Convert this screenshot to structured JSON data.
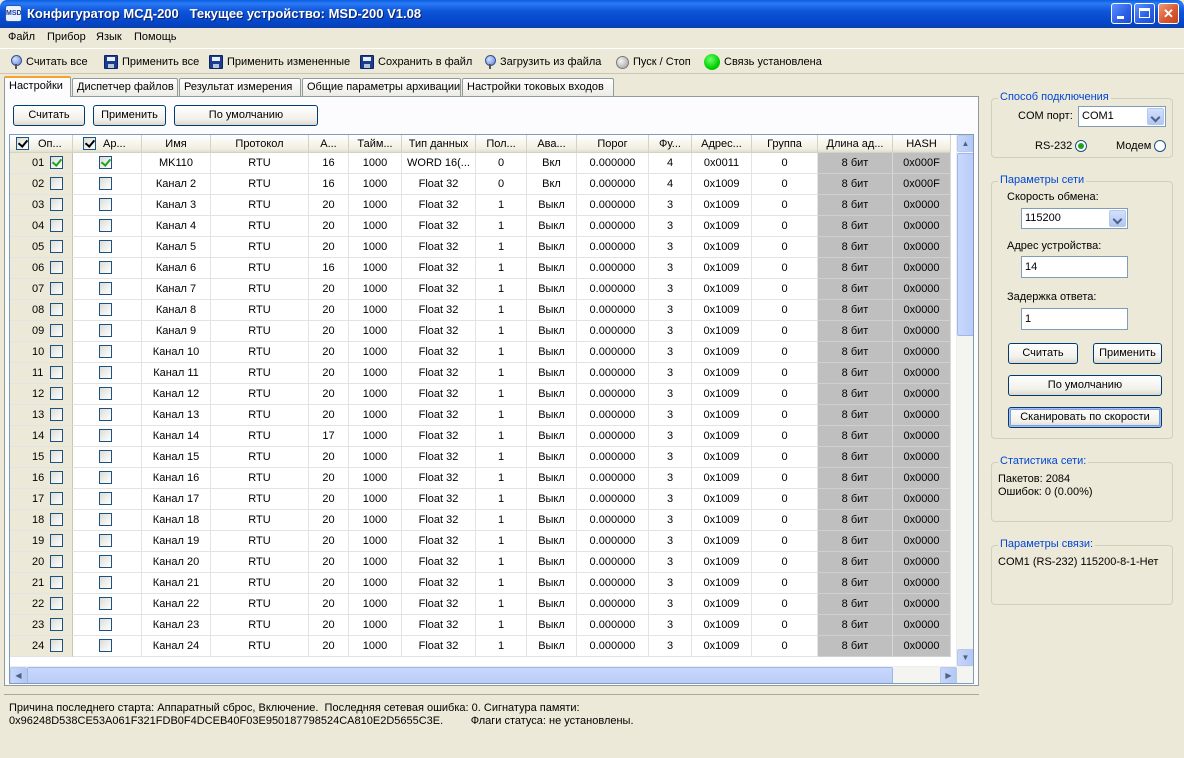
{
  "window": {
    "title": "Конфигуратор МСД-200   Текущее устройство: MSD-200 V1.08",
    "icon_text": "MSD"
  },
  "menu": [
    "Файл",
    "Прибор",
    "Язык",
    "Помощь"
  ],
  "toolbar": {
    "read_all": "Считать все",
    "apply_all": "Применить все",
    "apply_changed": "Применить измененные",
    "save_file": "Сохранить в файл",
    "load_file": "Загрузить из файла",
    "start_stop": "Пуск / Стоп",
    "connection": "Связь установлена",
    "connection_color": "#00d100"
  },
  "tabs": [
    "Настройки",
    "Диспетчер файлов",
    "Результат измерения",
    "Общие параметры архивации",
    "Настройки токовых входов"
  ],
  "panel_buttons": {
    "read": "Считать",
    "apply": "Применить",
    "default": "По умолчанию"
  },
  "table": {
    "columns": [
      "Оп...",
      "Ар...",
      "Имя",
      "Протокол",
      "А...",
      "Тайм...",
      "Тип данных",
      "Пол...",
      "Ава...",
      "Порог",
      "Фу...",
      "Адрес...",
      "Группа",
      "Длина ад...",
      "HASH"
    ],
    "rows": [
      {
        "n": "01",
        "op": true,
        "ar": true,
        "name": "MK110",
        "proto": "RTU",
        "a": "16",
        "t": "1000",
        "type": "WORD 16(...",
        "pol": "0",
        "ava": "Вкл",
        "thr": "0.000000",
        "fu": "4",
        "addr": "0x0011",
        "grp": "0",
        "len": "8 бит",
        "hash": "0x000F"
      },
      {
        "n": "02",
        "op": false,
        "ar": false,
        "name": "Канал 2",
        "proto": "RTU",
        "a": "16",
        "t": "1000",
        "type": "Float 32",
        "pol": "0",
        "ava": "Вкл",
        "thr": "0.000000",
        "fu": "4",
        "addr": "0x1009",
        "grp": "0",
        "len": "8 бит",
        "hash": "0x000F"
      },
      {
        "n": "03",
        "op": false,
        "ar": false,
        "name": "Канал 3",
        "proto": "RTU",
        "a": "20",
        "t": "1000",
        "type": "Float 32",
        "pol": "1",
        "ava": "Выкл",
        "thr": "0.000000",
        "fu": "3",
        "addr": "0x1009",
        "grp": "0",
        "len": "8 бит",
        "hash": "0x0000"
      },
      {
        "n": "04",
        "op": false,
        "ar": false,
        "name": "Канал 4",
        "proto": "RTU",
        "a": "20",
        "t": "1000",
        "type": "Float 32",
        "pol": "1",
        "ava": "Выкл",
        "thr": "0.000000",
        "fu": "3",
        "addr": "0x1009",
        "grp": "0",
        "len": "8 бит",
        "hash": "0x0000"
      },
      {
        "n": "05",
        "op": false,
        "ar": false,
        "name": "Канал 5",
        "proto": "RTU",
        "a": "20",
        "t": "1000",
        "type": "Float 32",
        "pol": "1",
        "ava": "Выкл",
        "thr": "0.000000",
        "fu": "3",
        "addr": "0x1009",
        "grp": "0",
        "len": "8 бит",
        "hash": "0x0000"
      },
      {
        "n": "06",
        "op": false,
        "ar": false,
        "name": "Канал 6",
        "proto": "RTU",
        "a": "16",
        "t": "1000",
        "type": "Float 32",
        "pol": "1",
        "ava": "Выкл",
        "thr": "0.000000",
        "fu": "3",
        "addr": "0x1009",
        "grp": "0",
        "len": "8 бит",
        "hash": "0x0000"
      },
      {
        "n": "07",
        "op": false,
        "ar": false,
        "name": "Канал 7",
        "proto": "RTU",
        "a": "20",
        "t": "1000",
        "type": "Float 32",
        "pol": "1",
        "ava": "Выкл",
        "thr": "0.000000",
        "fu": "3",
        "addr": "0x1009",
        "grp": "0",
        "len": "8 бит",
        "hash": "0x0000"
      },
      {
        "n": "08",
        "op": false,
        "ar": false,
        "name": "Канал 8",
        "proto": "RTU",
        "a": "20",
        "t": "1000",
        "type": "Float 32",
        "pol": "1",
        "ava": "Выкл",
        "thr": "0.000000",
        "fu": "3",
        "addr": "0x1009",
        "grp": "0",
        "len": "8 бит",
        "hash": "0x0000"
      },
      {
        "n": "09",
        "op": false,
        "ar": false,
        "name": "Канал 9",
        "proto": "RTU",
        "a": "20",
        "t": "1000",
        "type": "Float 32",
        "pol": "1",
        "ava": "Выкл",
        "thr": "0.000000",
        "fu": "3",
        "addr": "0x1009",
        "grp": "0",
        "len": "8 бит",
        "hash": "0x0000"
      },
      {
        "n": "10",
        "op": false,
        "ar": false,
        "name": "Канал 10",
        "proto": "RTU",
        "a": "20",
        "t": "1000",
        "type": "Float 32",
        "pol": "1",
        "ava": "Выкл",
        "thr": "0.000000",
        "fu": "3",
        "addr": "0x1009",
        "grp": "0",
        "len": "8 бит",
        "hash": "0x0000"
      },
      {
        "n": "11",
        "op": false,
        "ar": false,
        "name": "Канал 11",
        "proto": "RTU",
        "a": "20",
        "t": "1000",
        "type": "Float 32",
        "pol": "1",
        "ava": "Выкл",
        "thr": "0.000000",
        "fu": "3",
        "addr": "0x1009",
        "grp": "0",
        "len": "8 бит",
        "hash": "0x0000"
      },
      {
        "n": "12",
        "op": false,
        "ar": false,
        "name": "Канал 12",
        "proto": "RTU",
        "a": "20",
        "t": "1000",
        "type": "Float 32",
        "pol": "1",
        "ava": "Выкл",
        "thr": "0.000000",
        "fu": "3",
        "addr": "0x1009",
        "grp": "0",
        "len": "8 бит",
        "hash": "0x0000"
      },
      {
        "n": "13",
        "op": false,
        "ar": false,
        "name": "Канал 13",
        "proto": "RTU",
        "a": "20",
        "t": "1000",
        "type": "Float 32",
        "pol": "1",
        "ava": "Выкл",
        "thr": "0.000000",
        "fu": "3",
        "addr": "0x1009",
        "grp": "0",
        "len": "8 бит",
        "hash": "0x0000"
      },
      {
        "n": "14",
        "op": false,
        "ar": false,
        "name": "Канал 14",
        "proto": "RTU",
        "a": "17",
        "t": "1000",
        "type": "Float 32",
        "pol": "1",
        "ava": "Выкл",
        "thr": "0.000000",
        "fu": "3",
        "addr": "0x1009",
        "grp": "0",
        "len": "8 бит",
        "hash": "0x0000"
      },
      {
        "n": "15",
        "op": false,
        "ar": false,
        "name": "Канал 15",
        "proto": "RTU",
        "a": "20",
        "t": "1000",
        "type": "Float 32",
        "pol": "1",
        "ava": "Выкл",
        "thr": "0.000000",
        "fu": "3",
        "addr": "0x1009",
        "grp": "0",
        "len": "8 бит",
        "hash": "0x0000"
      },
      {
        "n": "16",
        "op": false,
        "ar": false,
        "name": "Канал 16",
        "proto": "RTU",
        "a": "20",
        "t": "1000",
        "type": "Float 32",
        "pol": "1",
        "ava": "Выкл",
        "thr": "0.000000",
        "fu": "3",
        "addr": "0x1009",
        "grp": "0",
        "len": "8 бит",
        "hash": "0x0000"
      },
      {
        "n": "17",
        "op": false,
        "ar": false,
        "name": "Канал 17",
        "proto": "RTU",
        "a": "20",
        "t": "1000",
        "type": "Float 32",
        "pol": "1",
        "ava": "Выкл",
        "thr": "0.000000",
        "fu": "3",
        "addr": "0x1009",
        "grp": "0",
        "len": "8 бит",
        "hash": "0x0000"
      },
      {
        "n": "18",
        "op": false,
        "ar": false,
        "name": "Канал 18",
        "proto": "RTU",
        "a": "20",
        "t": "1000",
        "type": "Float 32",
        "pol": "1",
        "ava": "Выкл",
        "thr": "0.000000",
        "fu": "3",
        "addr": "0x1009",
        "grp": "0",
        "len": "8 бит",
        "hash": "0x0000"
      },
      {
        "n": "19",
        "op": false,
        "ar": false,
        "name": "Канал 19",
        "proto": "RTU",
        "a": "20",
        "t": "1000",
        "type": "Float 32",
        "pol": "1",
        "ava": "Выкл",
        "thr": "0.000000",
        "fu": "3",
        "addr": "0x1009",
        "grp": "0",
        "len": "8 бит",
        "hash": "0x0000"
      },
      {
        "n": "20",
        "op": false,
        "ar": false,
        "name": "Канал 20",
        "proto": "RTU",
        "a": "20",
        "t": "1000",
        "type": "Float 32",
        "pol": "1",
        "ava": "Выкл",
        "thr": "0.000000",
        "fu": "3",
        "addr": "0x1009",
        "grp": "0",
        "len": "8 бит",
        "hash": "0x0000"
      },
      {
        "n": "21",
        "op": false,
        "ar": false,
        "name": "Канал 21",
        "proto": "RTU",
        "a": "20",
        "t": "1000",
        "type": "Float 32",
        "pol": "1",
        "ava": "Выкл",
        "thr": "0.000000",
        "fu": "3",
        "addr": "0x1009",
        "grp": "0",
        "len": "8 бит",
        "hash": "0x0000"
      },
      {
        "n": "22",
        "op": false,
        "ar": false,
        "name": "Канал 22",
        "proto": "RTU",
        "a": "20",
        "t": "1000",
        "type": "Float 32",
        "pol": "1",
        "ava": "Выкл",
        "thr": "0.000000",
        "fu": "3",
        "addr": "0x1009",
        "grp": "0",
        "len": "8 бит",
        "hash": "0x0000"
      },
      {
        "n": "23",
        "op": false,
        "ar": false,
        "name": "Канал 23",
        "proto": "RTU",
        "a": "20",
        "t": "1000",
        "type": "Float 32",
        "pol": "1",
        "ava": "Выкл",
        "thr": "0.000000",
        "fu": "3",
        "addr": "0x1009",
        "grp": "0",
        "len": "8 бит",
        "hash": "0x0000"
      },
      {
        "n": "24",
        "op": false,
        "ar": false,
        "name": "Канал 24",
        "proto": "RTU",
        "a": "20",
        "t": "1000",
        "type": "Float 32",
        "pol": "1",
        "ava": "Выкл",
        "thr": "0.000000",
        "fu": "3",
        "addr": "0x1009",
        "grp": "0",
        "len": "8 бит",
        "hash": "0x0000"
      }
    ]
  },
  "status": {
    "line1": "Причина последнего старта: Аппаратный сброс, Включение.  Последняя сетевая ошибка: 0. Сигнатура памяти:",
    "line2": "0x96248D538CE53A061F321FDB0F4DCEB40F03E950187798524CA810E2D5655C3E.         Флаги статуса: не установлены."
  },
  "connection_group": {
    "title": "Способ подключения",
    "com_label": "COM порт:",
    "com_value": "COM1",
    "rs232": "RS-232",
    "modem": "Модем"
  },
  "network_group": {
    "title": "Параметры сети",
    "speed_label": "Скорость обмена:",
    "speed_value": "115200",
    "addr_label": "Адрес устройства:",
    "addr_value": "14",
    "delay_label": "Задержка ответа:",
    "delay_value": "1",
    "read": "Считать",
    "apply": "Применить",
    "default": "По умолчанию",
    "scan": "Сканировать по скорости"
  },
  "stats_group": {
    "title": "Статистика сети:",
    "packets": "Пакетов: 2084",
    "errors": "Ошибок: 0 (0.00%)"
  },
  "link_group": {
    "title": "Параметры связи:",
    "value": "COM1 (RS-232)  115200-8-1-Нет"
  }
}
